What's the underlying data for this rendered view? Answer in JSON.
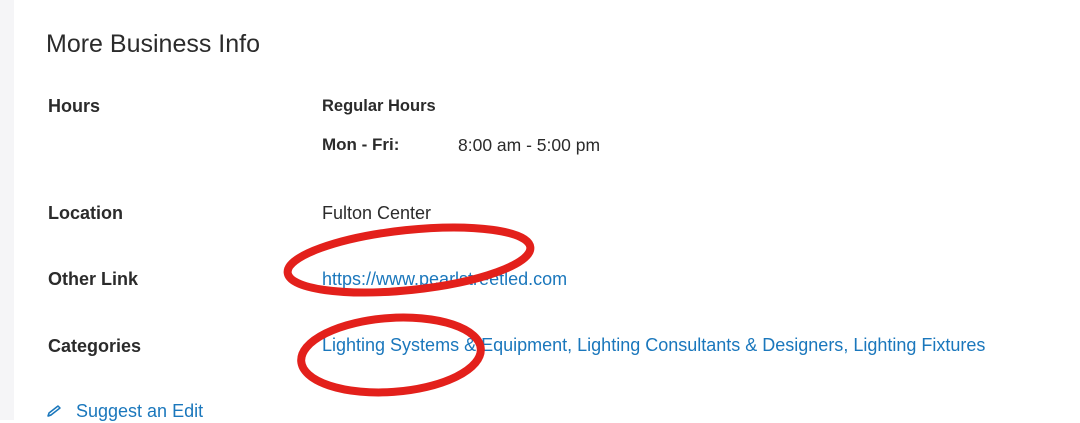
{
  "section": {
    "title": "More Business Info"
  },
  "hours": {
    "label": "Hours",
    "heading": "Regular Hours",
    "day": "Mon - Fri:",
    "time": "8:00 am - 5:00 pm"
  },
  "location": {
    "label": "Location",
    "value": "Fulton Center"
  },
  "other_link": {
    "label": "Other Link",
    "url": "https://www.pearlstreetled.com"
  },
  "categories": {
    "label": "Categories",
    "items": [
      "Lighting Systems & Equipment",
      "Lighting Consultants & Designers",
      "Lighting Fixtures"
    ],
    "separator": ", "
  },
  "suggest_edit": {
    "label": "Suggest an Edit",
    "icon": "pencil-icon"
  },
  "colors": {
    "link": "#1a77bc",
    "annotation": "#e3201b",
    "text": "#2b2b2b"
  }
}
